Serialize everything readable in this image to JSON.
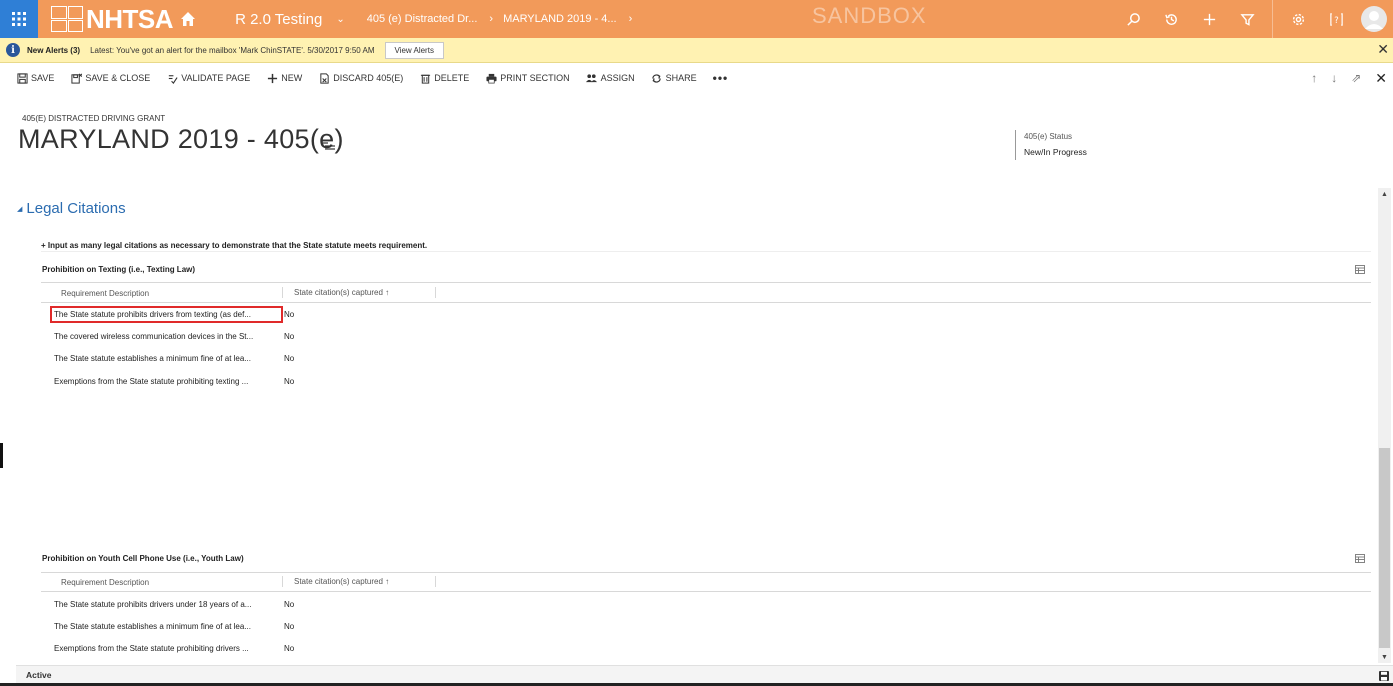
{
  "topnav": {
    "logo_text": "NHTSA",
    "area": "R 2.0 Testing",
    "breadcrumb": [
      "405 (e) Distracted Dr...",
      "MARYLAND 2019 - 4..."
    ],
    "sandbox_label": "SANDBOX",
    "accent_color": "#f29a5a",
    "waffle_color": "#2f7fd6",
    "icons": [
      "search-icon",
      "recent-icon",
      "new-icon",
      "filter-icon",
      "settings-icon",
      "help-icon",
      "user-avatar-icon"
    ]
  },
  "alerts": {
    "title": "New Alerts (3)",
    "message": "Latest: You've got an alert for the mailbox 'Mark ChinSTATE'. 5/30/2017 9:50 AM",
    "button": "View Alerts"
  },
  "commands": {
    "save": "SAVE",
    "save_close": "SAVE & CLOSE",
    "validate": "VALIDATE PAGE",
    "new": "NEW",
    "discard": "DISCARD 405(E)",
    "delete": "DELETE",
    "print": "PRINT SECTION",
    "assign": "ASSIGN",
    "share": "SHARE",
    "more": "•••"
  },
  "header": {
    "entity_type": "405(E) DISTRACTED DRIVING GRANT",
    "title": "MARYLAND 2019 - 405(e)",
    "status_label": "405(e) Status",
    "status_value": "New/In Progress"
  },
  "section": {
    "title": "Legal Citations",
    "helper": "+ Input as many legal citations as necessary to demonstrate that the State statute meets requirement."
  },
  "grid_texting": {
    "title": "Prohibition on Texting (i.e., Texting Law)",
    "col1": "Requirement Description",
    "col2": "State citation(s) captured ↑",
    "rows": [
      {
        "desc": "The State statute prohibits drivers from texting (as def...",
        "val": "No"
      },
      {
        "desc": "The covered wireless communication devices in the St...",
        "val": "No"
      },
      {
        "desc": "The State statute establishes a minimum fine of at lea...",
        "val": "No"
      },
      {
        "desc": "Exemptions from the State statute prohibiting texting ...",
        "val": "No"
      }
    ]
  },
  "grid_youth": {
    "title": "Prohibition on Youth Cell Phone Use (i.e., Youth Law)",
    "col1": "Requirement Description",
    "col2": "State citation(s) captured ↑",
    "rows": [
      {
        "desc": "The State statute prohibits drivers under 18 years of a...",
        "val": "No"
      },
      {
        "desc": "The State statute establishes a minimum fine of at lea...",
        "val": "No"
      },
      {
        "desc": "Exemptions from the State statute prohibiting drivers ...",
        "val": "No"
      }
    ]
  },
  "footer": {
    "status": "Active"
  }
}
